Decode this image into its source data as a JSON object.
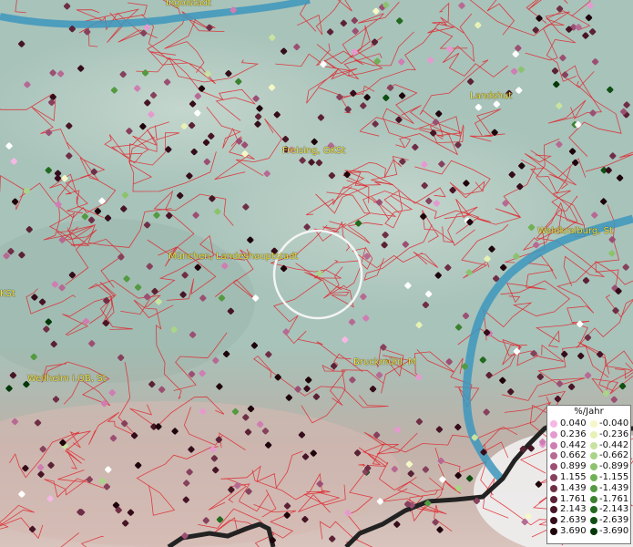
{
  "map": {
    "cities": [
      {
        "id": "ingolstadt",
        "name": "Ingolstadt"
      },
      {
        "id": "landshut",
        "name": "Landshut"
      },
      {
        "id": "freising",
        "name": "Freising, GKSt"
      },
      {
        "id": "muenchen",
        "name": "München, Landeshauptstadt"
      },
      {
        "id": "waldkraiburg",
        "name": "Waldkraiburg, St"
      },
      {
        "id": "ksi",
        "name": "KSt"
      },
      {
        "id": "weilheim",
        "name": "Weilheim i.OB, St"
      },
      {
        "id": "bruckmuehl",
        "name": "Bruckmühl, M"
      }
    ],
    "colors": {
      "pos": [
        "#f5b8e4",
        "#e59acf",
        "#cf7db2",
        "#b66a93",
        "#9b4f73",
        "#86415c",
        "#6e2f46",
        "#5b2135",
        "#471526",
        "#350c1a",
        "#1f040c"
      ],
      "neg": [
        "#f5f8c6",
        "#e6f1b4",
        "#c8e3a0",
        "#aad488",
        "#8cc26e",
        "#70b055",
        "#539a40",
        "#3b822e",
        "#236a1f",
        "#0f4f12",
        "#053808"
      ],
      "white": "#ffffff",
      "river": "#3d97bd",
      "border": "#e0242c"
    }
  },
  "legend": {
    "title": "%/Jahr",
    "positive": [
      "0.040",
      "0.236",
      "0.442",
      "0.662",
      "0.899",
      "1.155",
      "1.439",
      "1.761",
      "2.143",
      "2.639",
      "3.690"
    ],
    "negative": [
      "-0.040",
      "-0.236",
      "-0.442",
      "-0.662",
      "-0.899",
      "-1.155",
      "-1.439",
      "-1.761",
      "-2.143",
      "-2.639",
      "-3.690"
    ]
  }
}
